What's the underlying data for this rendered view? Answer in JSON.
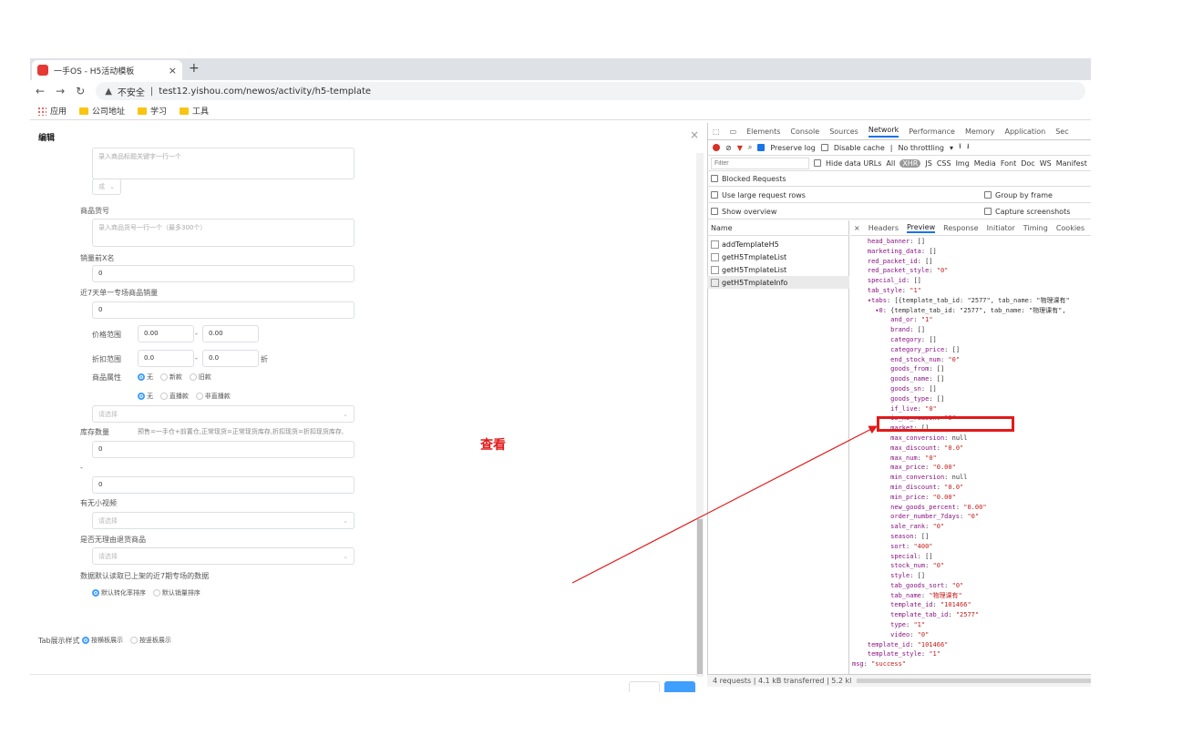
{
  "browser": {
    "tab_title": "一手OS - H5活动模板",
    "tab_close": "×",
    "new_tab": "+",
    "security_warning": "不安全",
    "url": "test12.yishou.com/newos/activity/h5-template",
    "bookmarks": [
      "应用",
      "公司地址",
      "学习",
      "工具"
    ]
  },
  "page": {
    "title": "编辑",
    "close": "×",
    "keyword_placeholder": "录入商品标题关键字一行一个",
    "or_select": "或",
    "goods_sn_label": "商品货号",
    "goods_sn_placeholder": "录入商品货号一行一个（最多300个）",
    "sale_rank_label": "销量前X名",
    "sale_rank_value": "0",
    "order7_label": "近7天单一专场商品销量",
    "order7_value": "0",
    "price_label": "价格范围",
    "price_min": "0.00",
    "price_max": "0.00",
    "dash": "-",
    "discount_label": "折扣范围",
    "discount_min": "0.0",
    "discount_max": "0.0",
    "discount_unit": "折",
    "attr_label": "商品属性",
    "attr_options1": [
      "无",
      "新款",
      "旧款"
    ],
    "attr_options2": [
      "无",
      "直播款",
      "非直播款"
    ],
    "select_placeholder": "请选择",
    "stock_label": "库存数量",
    "stock_hint": "预售=一手仓+前置仓,正常现货=正常现货库存,折扣现货=折扣现货库存,",
    "stock_min": "0",
    "stock_dash": "-",
    "stock_max": "0",
    "video_label": "有无小视频",
    "video_placeholder": "请选择",
    "no_reason_label": "是否无理由退货商品",
    "no_reason_placeholder": "请选择",
    "default_sort_label": "数据默认读取已上架的近7期专场的数据",
    "sort_options": [
      "默认转化率排序",
      "默认销量排序"
    ],
    "tab_style_label": "Tab展示样式",
    "tab_style_options": [
      "按横板展示",
      "按竖板展示"
    ],
    "annotation": "查看"
  },
  "devtools": {
    "tabs": [
      "Elements",
      "Console",
      "Sources",
      "Network",
      "Performance",
      "Memory",
      "Application",
      "Sec"
    ],
    "active_tab": "Network",
    "toolbar": {
      "preserve_log": "Preserve log",
      "disable_cache": "Disable cache",
      "throttling": "No throttling"
    },
    "filter_placeholder": "Filter",
    "hide_data_urls": "Hide data URLs",
    "filter_types": [
      "All",
      "XHR",
      "JS",
      "CSS",
      "Img",
      "Media",
      "Font",
      "Doc",
      "WS",
      "Manifest"
    ],
    "blocked_requests": "Blocked Requests",
    "large_rows": "Use large request rows",
    "group_by_frame": "Group by frame",
    "show_overview": "Show overview",
    "capture_screenshots": "Capture screenshots",
    "name_header": "Name",
    "requests": [
      "addTemplateH5",
      "getH5TmplateList",
      "getH5TmplateList",
      "getH5TmplateInfo"
    ],
    "detail_tabs": [
      "×",
      "Headers",
      "Preview",
      "Response",
      "Initiator",
      "Timing",
      "Cookies"
    ],
    "active_detail": "Preview",
    "status": "4 requests | 4.1 kB transferred | 5.2 kl"
  },
  "preview_lines": [
    {
      "indent": 2,
      "key": "head_banner",
      "val": "[]",
      "t": "g"
    },
    {
      "indent": 2,
      "key": "marketing_data",
      "val": "[]",
      "t": "g"
    },
    {
      "indent": 2,
      "key": "red_packet_id",
      "val": "[]",
      "t": "g"
    },
    {
      "indent": 2,
      "key": "red_packet_style",
      "val": "\"0\"",
      "t": "s"
    },
    {
      "indent": 2,
      "key": "special_id",
      "val": "[]",
      "t": "g"
    },
    {
      "indent": 2,
      "key": "tab_style",
      "val": "\"1\"",
      "t": "s"
    },
    {
      "indent": 2,
      "key": "▾tabs",
      "val": "[{template_tab_id: \"2577\", tab_name: \"物理课有\"",
      "t": "g"
    },
    {
      "indent": 3,
      "key": "▾0",
      "val": "{template_tab_id: \"2577\", tab_name: \"物理课有\",",
      "t": "g"
    },
    {
      "indent": 5,
      "key": "and_or",
      "val": "\"1\"",
      "t": "s"
    },
    {
      "indent": 5,
      "key": "brand",
      "val": "[]",
      "t": "g"
    },
    {
      "indent": 5,
      "key": "category",
      "val": "[]",
      "t": "g"
    },
    {
      "indent": 5,
      "key": "category_price",
      "val": "[]",
      "t": "g"
    },
    {
      "indent": 5,
      "key": "end_stock_num",
      "val": "\"0\"",
      "t": "s"
    },
    {
      "indent": 5,
      "key": "goods_from",
      "val": "[]",
      "t": "g"
    },
    {
      "indent": 5,
      "key": "goods_name",
      "val": "[]",
      "t": "g"
    },
    {
      "indent": 5,
      "key": "goods_sn",
      "val": "[]",
      "t": "g"
    },
    {
      "indent": 5,
      "key": "goods_type",
      "val": "[]",
      "t": "g"
    },
    {
      "indent": 5,
      "key": "if_live",
      "val": "\"0\"",
      "t": "s"
    },
    {
      "indent": 5,
      "key": "is_no_reason",
      "val": "\"0\"",
      "t": "s"
    },
    {
      "indent": 5,
      "key": "market",
      "val": "[]",
      "t": "g"
    },
    {
      "indent": 5,
      "key": "max_conversion",
      "val": "null",
      "t": "g"
    },
    {
      "indent": 5,
      "key": "max_discount",
      "val": "\"0.0\"",
      "t": "s"
    },
    {
      "indent": 5,
      "key": "max_num",
      "val": "\"0\"",
      "t": "s"
    },
    {
      "indent": 5,
      "key": "max_price",
      "val": "\"0.00\"",
      "t": "s"
    },
    {
      "indent": 5,
      "key": "min_conversion",
      "val": "null",
      "t": "g"
    },
    {
      "indent": 5,
      "key": "min_discount",
      "val": "\"0.0\"",
      "t": "s"
    },
    {
      "indent": 5,
      "key": "min_price",
      "val": "\"0.00\"",
      "t": "s"
    },
    {
      "indent": 5,
      "key": "new_goods_percent",
      "val": "\"0.00\"",
      "t": "s"
    },
    {
      "indent": 5,
      "key": "order_number_7days",
      "val": "\"0\"",
      "t": "s"
    },
    {
      "indent": 5,
      "key": "sale_rank",
      "val": "\"0\"",
      "t": "s"
    },
    {
      "indent": 5,
      "key": "season",
      "val": "[]",
      "t": "g"
    },
    {
      "indent": 5,
      "key": "sort",
      "val": "\"400\"",
      "t": "s"
    },
    {
      "indent": 5,
      "key": "special",
      "val": "[]",
      "t": "g"
    },
    {
      "indent": 5,
      "key": "stock_num",
      "val": "\"0\"",
      "t": "s"
    },
    {
      "indent": 5,
      "key": "style",
      "val": "[]",
      "t": "g"
    },
    {
      "indent": 5,
      "key": "tab_goods_sort",
      "val": "\"0\"",
      "t": "s"
    },
    {
      "indent": 5,
      "key": "tab_name",
      "val": "\"物理课有\"",
      "t": "s"
    },
    {
      "indent": 5,
      "key": "template_id",
      "val": "\"101466\"",
      "t": "s"
    },
    {
      "indent": 5,
      "key": "template_tab_id",
      "val": "\"2577\"",
      "t": "s"
    },
    {
      "indent": 5,
      "key": "type",
      "val": "\"1\"",
      "t": "s"
    },
    {
      "indent": 5,
      "key": "video",
      "val": "\"0\"",
      "t": "s"
    },
    {
      "indent": 2,
      "key": "template_id",
      "val": "\"101466\"",
      "t": "s"
    },
    {
      "indent": 2,
      "key": "template_style",
      "val": "\"1\"",
      "t": "s"
    },
    {
      "indent": 0,
      "key": "msg",
      "val": "\"success\"",
      "t": "s"
    }
  ],
  "colors": {
    "highlight": "#e21a1a",
    "accent": "#409eff",
    "devtools_blue": "#1a73e8"
  }
}
